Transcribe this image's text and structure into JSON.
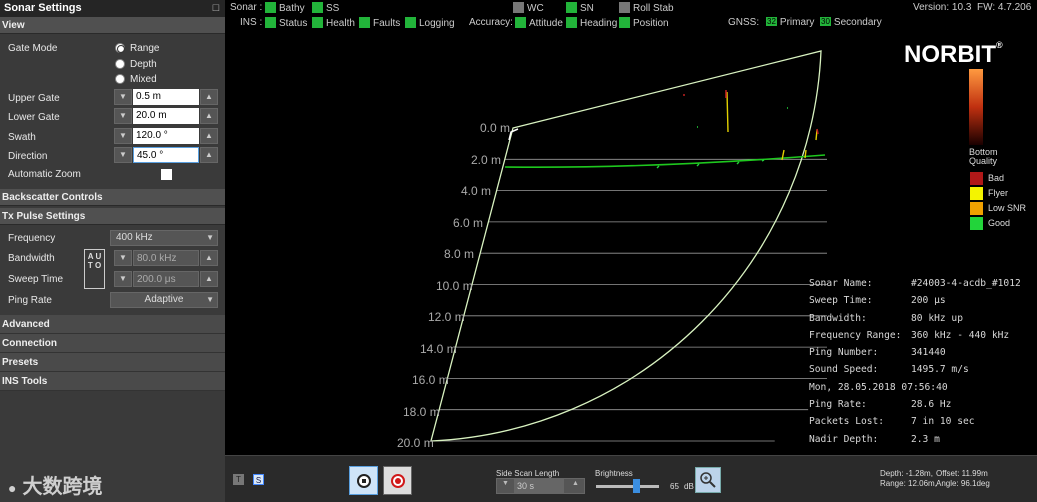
{
  "left_panel": {
    "title": "Sonar Settings",
    "pin": "☐",
    "view_section": "View",
    "gate_mode_label": "Gate Mode",
    "gate_options": [
      "Range",
      "Depth",
      "Mixed"
    ],
    "gate_selected": "Range",
    "upper_gate_label": "Upper Gate",
    "upper_gate_value": "0.5 m",
    "lower_gate_label": "Lower Gate",
    "lower_gate_value": "20.0 m",
    "swath_label": "Swath",
    "swath_value": "120.0 °",
    "direction_label": "Direction",
    "direction_value": "45.0 °",
    "auto_zoom_label": "Automatic Zoom",
    "backscatter_section": "Backscatter Controls",
    "tx_section": "Tx Pulse Settings",
    "frequency_label": "Frequency",
    "frequency_value": "400 kHz",
    "bandwidth_label": "Bandwidth",
    "bandwidth_value": "80.0 kHz",
    "sweep_label": "Sweep Time",
    "sweep_value": "200.0 μs",
    "auto_text": "A U T O",
    "ping_rate_label": "Ping Rate",
    "ping_rate_value": "Adaptive",
    "collapsed_sections": [
      "Advanced",
      "Connection",
      "Presets",
      "INS Tools"
    ]
  },
  "status": {
    "sonar_label": "Sonar :",
    "sonar_items": [
      "Bathy",
      "SS"
    ],
    "mode_items": [
      "WC",
      "SN",
      "Roll Stab"
    ],
    "version": "Version: 10.3",
    "fw": "FW: 4.7.206",
    "ins_label": "INS :",
    "ins_items": [
      "Status",
      "Health",
      "Faults",
      "Logging"
    ],
    "accuracy_label": "Accuracy:",
    "accuracy_items": [
      "Attitude",
      "Heading",
      "Position"
    ],
    "gnss_label": "GNSS:",
    "gnss_primary_count": "32",
    "gnss_primary": "Primary",
    "gnss_secondary_count": "30",
    "gnss_secondary": "Secondary"
  },
  "display": {
    "logo": "NORBIT",
    "logo_reg": "®",
    "depth_labels": [
      "0.0 m",
      "2.0 m",
      "4.0 m",
      "6.0 m",
      "8.0 m",
      "10.0 m",
      "12.0 m",
      "14.0 m",
      "16.0 m",
      "18.0 m",
      "20.0 m"
    ],
    "legend_title": "Bottom Quality",
    "legend_items": [
      {
        "label": "Bad",
        "color": "#b01818"
      },
      {
        "label": "Flyer",
        "color": "#f4f400"
      },
      {
        "label": "Low SNR",
        "color": "#f0a000"
      },
      {
        "label": "Good",
        "color": "#22d43a"
      }
    ],
    "info": [
      {
        "key": "Sonar Name:",
        "value": "#24003-4-acdb_#1012"
      },
      {
        "key": "Sweep Time:",
        "value": "200 μs"
      },
      {
        "key": "Bandwidth:",
        "value": "80 kHz up"
      },
      {
        "key": "Frequency Range:",
        "value": "360 kHz - 440 kHz"
      },
      {
        "key": "Ping Number:",
        "value": "341440"
      },
      {
        "key": "Sound Speed:",
        "value": "1495.7 m/s"
      },
      {
        "key": "Mon, 28.05.2018 07:56:40",
        "value": ""
      },
      {
        "key": "Ping Rate:",
        "value": "28.6 Hz"
      },
      {
        "key": "Packets Lost:",
        "value": "7 in 10 sec"
      },
      {
        "key": "Nadir Depth:",
        "value": "2.3 m"
      }
    ]
  },
  "toolbar": {
    "t_label": "T",
    "s_label": "S",
    "side_scan_label": "Side Scan Length",
    "side_scan_value": "30  s",
    "brightness_label": "Brightness",
    "brightness_value": "65",
    "brightness_unit": "dB",
    "brightness_level": 0.65,
    "readout_depth": "Depth: -1.28m,",
    "readout_offset": "Offset: 11.99m",
    "readout_range": "Range: 12.06m,",
    "readout_angle": "Angle: 96.1deg"
  },
  "watermark": "大数跨境",
  "colors": {
    "good": "#22b43a",
    "fan": "#d8f2c0",
    "swath_line": "#1ec81e"
  }
}
